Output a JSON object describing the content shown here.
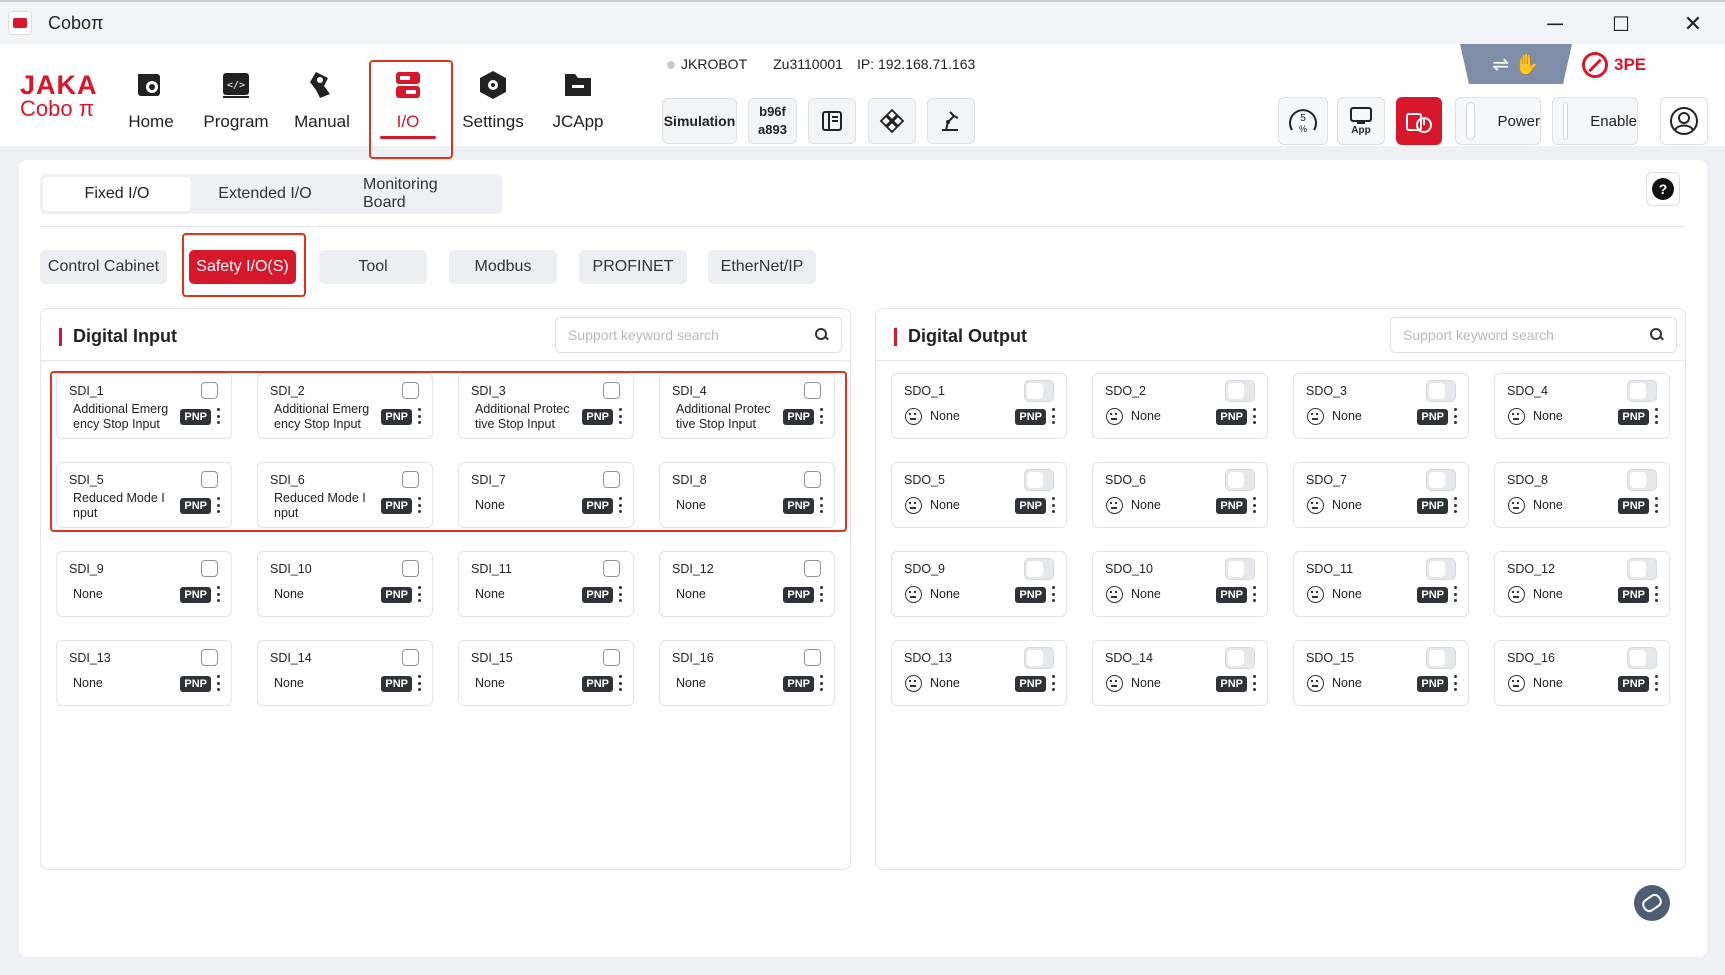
{
  "window": {
    "title": "Coboπ",
    "minimize": "─",
    "maximize": "☐",
    "close": "✕"
  },
  "brand": {
    "line1": "JAKA",
    "line2": "Cobo π"
  },
  "nav": [
    {
      "label": "Home",
      "icon": "home-robot-icon"
    },
    {
      "label": "Program",
      "icon": "program-code-icon"
    },
    {
      "label": "Manual",
      "icon": "manual-arm-icon"
    },
    {
      "label": "I/O",
      "icon": "io-icon",
      "active": true
    },
    {
      "label": "Settings",
      "icon": "settings-hex-icon"
    },
    {
      "label": "JCApp",
      "icon": "folder-app-icon"
    }
  ],
  "connection": {
    "name": "JKROBOT",
    "serial": "Zu3110001",
    "ip": "IP: 192.168.71.163"
  },
  "toolbar": {
    "simulation": "Simulation",
    "code_line1": "b96f",
    "code_line2": "a893",
    "speed": "5",
    "speed_unit": "%",
    "app": "App",
    "power": "Power",
    "enable": "Enable",
    "three_pe": "3PE",
    "hand_symbol": "⇌ ✋"
  },
  "tabs": [
    {
      "label": "Fixed I/O",
      "active": true
    },
    {
      "label": "Extended I/O"
    },
    {
      "label": "Monitoring Board"
    }
  ],
  "help": "?",
  "subtabs": [
    {
      "label": "Control Cabinet"
    },
    {
      "label": "Safety I/O(S)",
      "active": true
    },
    {
      "label": "Tool"
    },
    {
      "label": "Modbus"
    },
    {
      "label": "PROFINET"
    },
    {
      "label": "EtherNet/IP"
    }
  ],
  "digital_input": {
    "title": "Digital Input",
    "search_placeholder": "Support keyword search",
    "items": [
      {
        "name": "SDI_1",
        "desc": "Additional Emergency Stop Input",
        "desc_lines": [
          "Additional Emerg",
          "ency Stop Input"
        ],
        "mode": "PNP",
        "checked": false
      },
      {
        "name": "SDI_2",
        "desc": "Additional Emergency Stop Input",
        "desc_lines": [
          "Additional Emerg",
          "ency Stop Input"
        ],
        "mode": "PNP",
        "checked": false
      },
      {
        "name": "SDI_3",
        "desc": "Additional Protective Stop Input",
        "desc_lines": [
          "Additional Protec",
          "tive Stop Input"
        ],
        "mode": "PNP",
        "checked": false
      },
      {
        "name": "SDI_4",
        "desc": "Additional Protective Stop Input",
        "desc_lines": [
          "Additional Protec",
          "tive Stop Input"
        ],
        "mode": "PNP",
        "checked": false
      },
      {
        "name": "SDI_5",
        "desc": "Reduced Mode Input",
        "desc_lines": [
          "Reduced Mode I",
          "nput"
        ],
        "mode": "PNP",
        "checked": false
      },
      {
        "name": "SDI_6",
        "desc": "Reduced Mode Input",
        "desc_lines": [
          "Reduced Mode I",
          "nput"
        ],
        "mode": "PNP",
        "checked": false
      },
      {
        "name": "SDI_7",
        "desc": "None",
        "desc_lines": [
          "None"
        ],
        "mode": "PNP",
        "checked": false
      },
      {
        "name": "SDI_8",
        "desc": "None",
        "desc_lines": [
          "None"
        ],
        "mode": "PNP",
        "checked": false
      },
      {
        "name": "SDI_9",
        "desc": "None",
        "desc_lines": [
          "None"
        ],
        "mode": "PNP",
        "checked": false
      },
      {
        "name": "SDI_10",
        "desc": "None",
        "desc_lines": [
          "None"
        ],
        "mode": "PNP",
        "checked": false
      },
      {
        "name": "SDI_11",
        "desc": "None",
        "desc_lines": [
          "None"
        ],
        "mode": "PNP",
        "checked": false
      },
      {
        "name": "SDI_12",
        "desc": "None",
        "desc_lines": [
          "None"
        ],
        "mode": "PNP",
        "checked": false
      },
      {
        "name": "SDI_13",
        "desc": "None",
        "desc_lines": [
          "None"
        ],
        "mode": "PNP",
        "checked": false
      },
      {
        "name": "SDI_14",
        "desc": "None",
        "desc_lines": [
          "None"
        ],
        "mode": "PNP",
        "checked": false
      },
      {
        "name": "SDI_15",
        "desc": "None",
        "desc_lines": [
          "None"
        ],
        "mode": "PNP",
        "checked": false
      },
      {
        "name": "SDI_16",
        "desc": "None",
        "desc_lines": [
          "None"
        ],
        "mode": "PNP",
        "checked": false
      }
    ]
  },
  "digital_output": {
    "title": "Digital Output",
    "search_placeholder": "Support keyword search",
    "items": [
      {
        "name": "SDO_1",
        "desc": "None",
        "mode": "PNP",
        "on": false
      },
      {
        "name": "SDO_2",
        "desc": "None",
        "mode": "PNP",
        "on": false
      },
      {
        "name": "SDO_3",
        "desc": "None",
        "mode": "PNP",
        "on": false
      },
      {
        "name": "SDO_4",
        "desc": "None",
        "mode": "PNP",
        "on": false
      },
      {
        "name": "SDO_5",
        "desc": "None",
        "mode": "PNP",
        "on": false
      },
      {
        "name": "SDO_6",
        "desc": "None",
        "mode": "PNP",
        "on": false
      },
      {
        "name": "SDO_7",
        "desc": "None",
        "mode": "PNP",
        "on": false
      },
      {
        "name": "SDO_8",
        "desc": "None",
        "mode": "PNP",
        "on": false
      },
      {
        "name": "SDO_9",
        "desc": "None",
        "mode": "PNP",
        "on": false
      },
      {
        "name": "SDO_10",
        "desc": "None",
        "mode": "PNP",
        "on": false
      },
      {
        "name": "SDO_11",
        "desc": "None",
        "mode": "PNP",
        "on": false
      },
      {
        "name": "SDO_12",
        "desc": "None",
        "mode": "PNP",
        "on": false
      },
      {
        "name": "SDO_13",
        "desc": "None",
        "mode": "PNP",
        "on": false
      },
      {
        "name": "SDO_14",
        "desc": "None",
        "mode": "PNP",
        "on": false
      },
      {
        "name": "SDO_15",
        "desc": "None",
        "mode": "PNP",
        "on": false
      },
      {
        "name": "SDO_16",
        "desc": "None",
        "mode": "PNP",
        "on": false
      }
    ]
  },
  "colors": {
    "accent": "#d7182a",
    "highlight_box": "#e2311f",
    "pnp_badge": "#2f3237"
  }
}
